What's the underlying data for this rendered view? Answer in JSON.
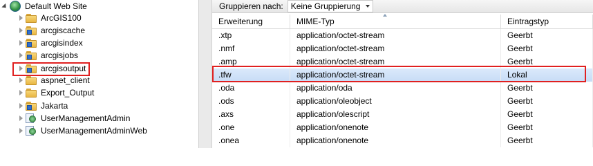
{
  "tree": {
    "root": "Default Web Site",
    "items": [
      {
        "label": "ArcGIS100",
        "icon": "folder-icon"
      },
      {
        "label": "arcgiscache",
        "icon": "app-folder-icon"
      },
      {
        "label": "arcgisindex",
        "icon": "app-folder-icon"
      },
      {
        "label": "arcgisjobs",
        "icon": "app-folder-icon"
      },
      {
        "label": "arcgisoutput",
        "icon": "app-folder-icon"
      },
      {
        "label": "aspnet_client",
        "icon": "folder-icon"
      },
      {
        "label": "Export_Output",
        "icon": "folder-icon"
      },
      {
        "label": "Jakarta",
        "icon": "app-folder-icon"
      },
      {
        "label": "UserManagementAdmin",
        "icon": "web-app-icon"
      },
      {
        "label": "UserManagementAdminWeb",
        "icon": "web-app-icon"
      }
    ]
  },
  "toolbar": {
    "group_label": "Gruppieren nach:",
    "group_value": "Keine Gruppierung"
  },
  "table": {
    "headers": [
      "Erweiterung",
      "MIME-Typ",
      "Eintragstyp"
    ],
    "rows": [
      [
        ".xtp",
        "application/octet-stream",
        "Geerbt"
      ],
      [
        ".nmf",
        "application/octet-stream",
        "Geerbt"
      ],
      [
        ".amp",
        "application/octet-stream",
        "Geerbt"
      ],
      [
        ".tfw",
        "application/octet-stream",
        "Lokal"
      ],
      [
        ".oda",
        "application/oda",
        "Geerbt"
      ],
      [
        ".ods",
        "application/oleobject",
        "Geerbt"
      ],
      [
        ".axs",
        "application/olescript",
        "Geerbt"
      ],
      [
        ".one",
        "application/onenote",
        "Geerbt"
      ],
      [
        ".onea",
        "application/onenote",
        "Geerbt"
      ]
    ]
  },
  "colors": {
    "highlight": "#e02020",
    "selection": "#cfe0f7"
  }
}
